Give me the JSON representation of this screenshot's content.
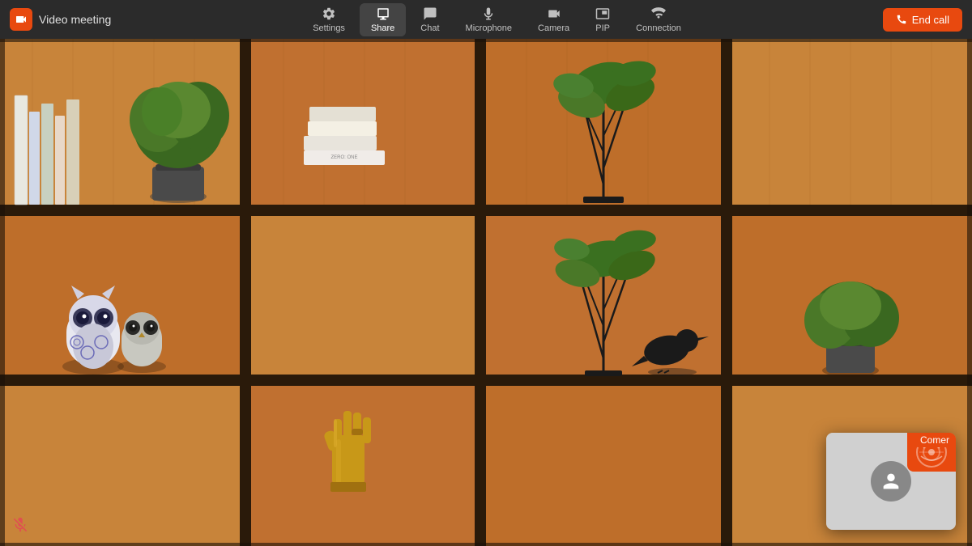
{
  "app": {
    "title": "Video meeting",
    "logo_text": "🎥"
  },
  "topbar": {
    "settings_label": "Settings",
    "share_label": "Share",
    "chat_label": "Chat",
    "microphone_label": "Microphone",
    "camera_label": "Camera",
    "pip_label": "PIP",
    "connection_label": "Connection",
    "end_call_label": "End call",
    "active_tab": "Share"
  },
  "pip": {
    "user_name": "Comer"
  },
  "mic_indicator": {
    "muted": true
  }
}
